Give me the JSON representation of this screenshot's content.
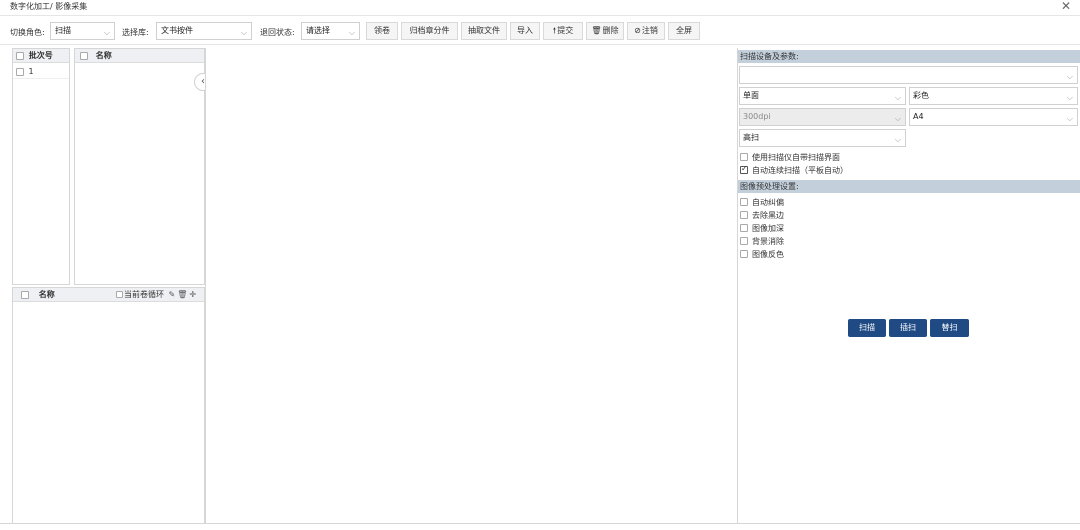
{
  "window": {
    "title": "数字化加工/ 影像采集",
    "close_glyph": "✕"
  },
  "toolbar": {
    "role_label": "切换角色:",
    "role_value": "扫描",
    "library_label": "选择库:",
    "library_value": "文书按件",
    "return_label": "退回状态:",
    "return_value": "请选择",
    "buttons": {
      "claim": "领卷",
      "archive_split": "归档章分件",
      "extract": "抽取文件",
      "import": "导入",
      "submit": "提交",
      "delete": "删除",
      "cancel": "注销",
      "fullscreen": "全屏"
    },
    "icons": {
      "chevron": "⌵",
      "arrow_up": "🠕",
      "delete_icon": "🗑",
      "cancel_icon": "⊘"
    }
  },
  "left": {
    "batch_header": "批次号",
    "batch_rows": [
      "1"
    ],
    "name_header": "名称",
    "bottom_name_header": "名称",
    "current_loop_label": "当前卷循环",
    "collapse_glyph": "‹"
  },
  "right": {
    "scan_section": "扫描设备及参数:",
    "device_value": "",
    "side_value": "单面",
    "color_value": "彩色",
    "dpi_value": "300dpi",
    "paper_value": "A4",
    "mode_value": "高扫",
    "use_native_ui": "使用扫描仪自带扫描界面",
    "auto_continuous": "自动连续扫描（平板自动）",
    "auto_continuous_checked": true,
    "preprocess_section": "图像预处理设置:",
    "preprocess_options": [
      "自动纠偏",
      "去除黑边",
      "图像加深",
      "背景消除",
      "图像反色"
    ],
    "buttons": {
      "scan": "扫描",
      "insert": "插扫",
      "replace": "替扫"
    }
  }
}
